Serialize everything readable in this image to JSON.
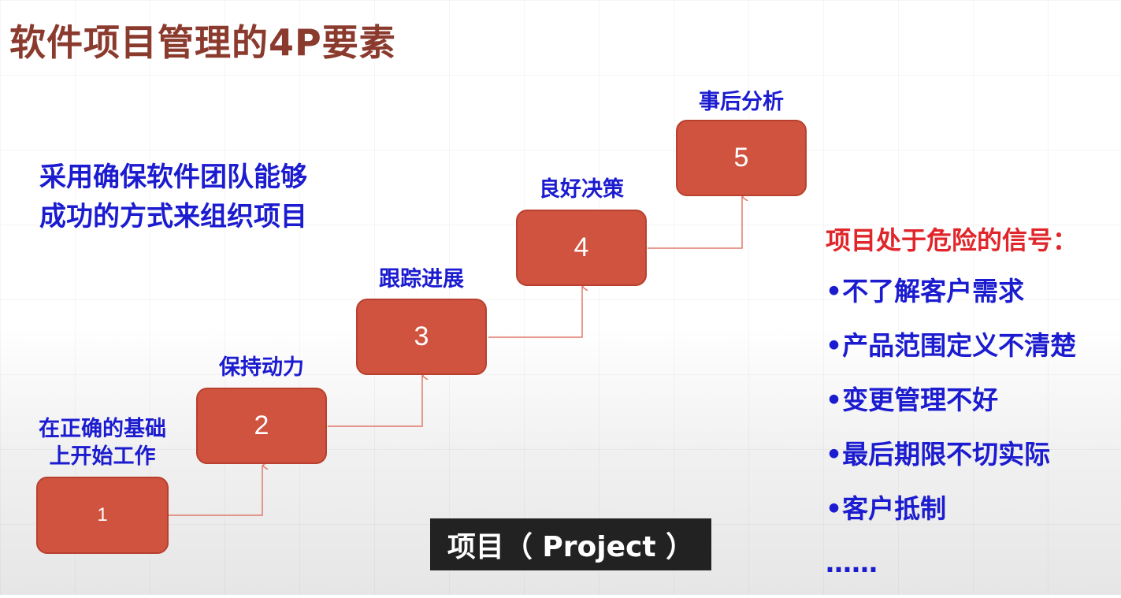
{
  "title": "软件项目管理的4P要素",
  "description": "采用确保软件团队能够成功的方式来组织项目",
  "steps": [
    {
      "number": "1",
      "label": "在正确的基础\n上开始工作"
    },
    {
      "number": "2",
      "label": "保持动力"
    },
    {
      "number": "3",
      "label": "跟踪进展"
    },
    {
      "number": "4",
      "label": "良好决策"
    },
    {
      "number": "5",
      "label": "事后分析"
    }
  ],
  "risk": {
    "title": "项目处于危险的信号：",
    "items": [
      "•不了解客户需求",
      "•产品范围定义不清楚",
      "•变更管理不好",
      "•最后期限不切实际",
      "•客户抵制",
      "……"
    ]
  },
  "caption": "项目（ Project ）",
  "colors": {
    "box": "#d0533f",
    "title": "#8b3a2e",
    "text": "#1b1bd0",
    "risk": "#e0262a",
    "connector": "#e07a6a"
  }
}
